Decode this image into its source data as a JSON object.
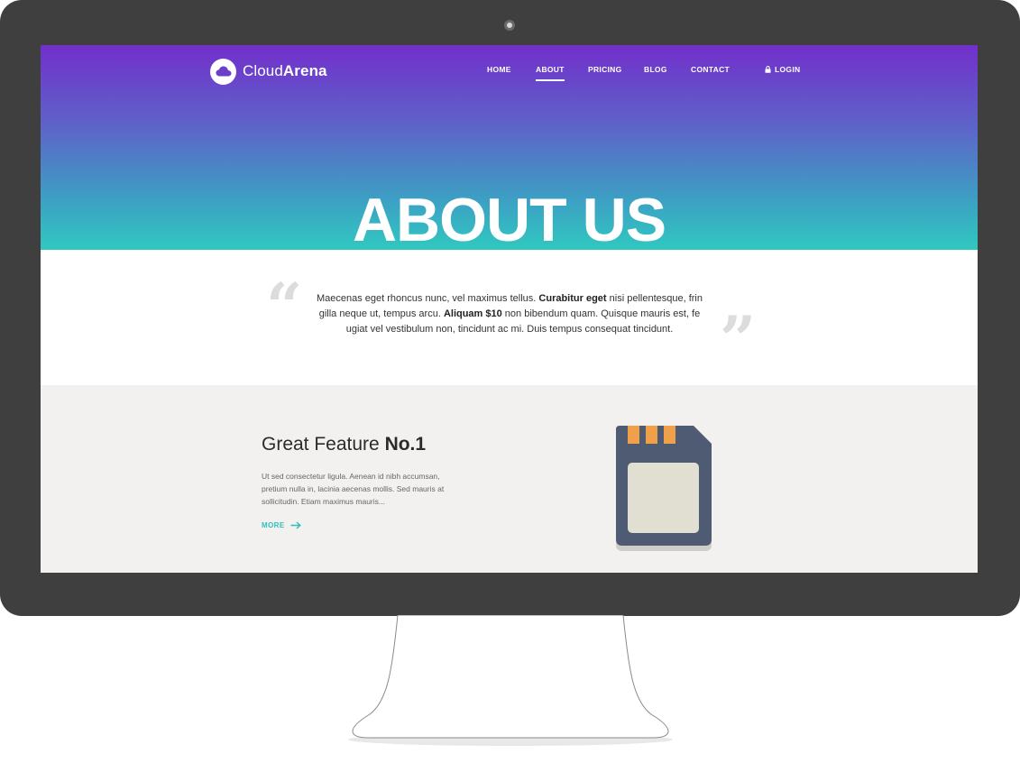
{
  "brand": {
    "name_light": "Cloud",
    "name_bold": "Arena"
  },
  "nav": {
    "items": [
      {
        "label": "HOME",
        "active": false
      },
      {
        "label": "ABOUT",
        "active": true
      },
      {
        "label": "PRICING",
        "active": false
      },
      {
        "label": "BLOG",
        "active": false
      },
      {
        "label": "CONTACT",
        "active": false
      }
    ],
    "login_label": "LOGIN"
  },
  "hero": {
    "title": "ABOUT US"
  },
  "quote": {
    "open_mark": "“",
    "close_mark": "”",
    "parts": [
      "Maecenas eget rhoncus nunc, vel maximus tellus. ",
      "Curabitur eget",
      " nisi pellentesque, frin gilla neque ut, tempus arcu. ",
      "Aliquam $10",
      " non bibendum quam. Quisque mauris est, fe ugiat vel vestibulum non, tincidunt ac mi. Duis tempus consequat tincidunt."
    ]
  },
  "feature": {
    "title_light": "Great Feature ",
    "title_bold": "No.1",
    "description": "Ut sed consectetur ligula. Aenean id nibh accumsan, pretium nulla in, lacinia aecenas mollis. Sed mauris at sollicitudin. Etiam maximus mauris...",
    "more_label": "MORE",
    "icon": "sim-card-icon"
  },
  "colors": {
    "gradient_top": "#722fcb",
    "gradient_bottom": "#30c8c0",
    "accent": "#2ec0b8",
    "bezel": "#3f3f3f",
    "feature_bg": "#f2f1f0",
    "sim_body": "#4f5b72",
    "sim_contacts": "#f0a048",
    "sim_chip": "#e0dfd2"
  }
}
